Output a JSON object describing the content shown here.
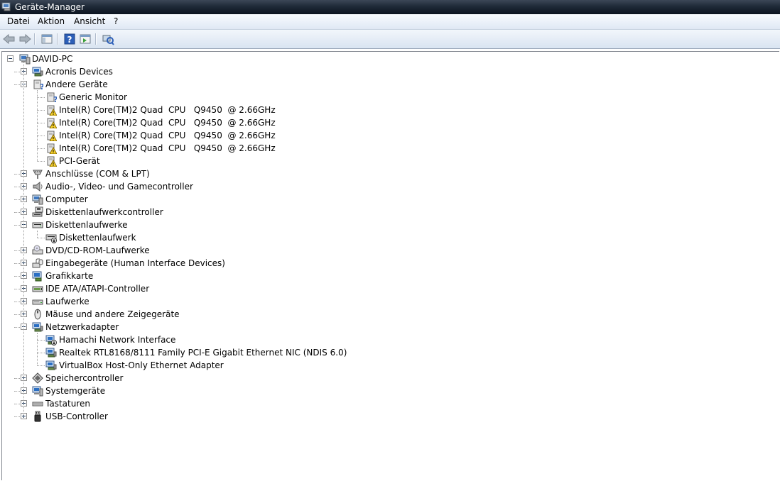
{
  "window": {
    "title": "Geräte-Manager"
  },
  "menu": {
    "items": [
      "Datei",
      "Aktion",
      "Ansicht",
      "?"
    ]
  },
  "tree": {
    "root": "DAVID-PC",
    "nodes": [
      {
        "label": "Acronis Devices",
        "level": 1,
        "state": "collapsed",
        "icon": "network-adapter-icon"
      },
      {
        "label": "Andere Geräte",
        "level": 1,
        "state": "expanded",
        "icon": "unknown-device-icon"
      },
      {
        "label": "Generic Monitor",
        "level": 2,
        "icon": "unknown-device-icon"
      },
      {
        "label": "Intel(R) Core(TM)2 Quad  CPU   Q9450  @ 2.66GHz",
        "level": 2,
        "icon": "warning-device-icon"
      },
      {
        "label": "Intel(R) Core(TM)2 Quad  CPU   Q9450  @ 2.66GHz",
        "level": 2,
        "icon": "warning-device-icon"
      },
      {
        "label": "Intel(R) Core(TM)2 Quad  CPU   Q9450  @ 2.66GHz",
        "level": 2,
        "icon": "warning-device-icon"
      },
      {
        "label": "Intel(R) Core(TM)2 Quad  CPU   Q9450  @ 2.66GHz",
        "level": 2,
        "icon": "warning-device-icon"
      },
      {
        "label": "PCI-Gerät",
        "level": 2,
        "icon": "warning-device-icon"
      },
      {
        "label": "Anschlüsse (COM & LPT)",
        "level": 1,
        "state": "collapsed",
        "icon": "port-icon"
      },
      {
        "label": "Audio-, Video- und Gamecontroller",
        "level": 1,
        "state": "collapsed",
        "icon": "speaker-icon"
      },
      {
        "label": "Computer",
        "level": 1,
        "state": "collapsed",
        "icon": "computer-icon"
      },
      {
        "label": "Diskettenlaufwerkcontroller",
        "level": 1,
        "state": "collapsed",
        "icon": "floppy-controller-icon"
      },
      {
        "label": "Diskettenlaufwerke",
        "level": 1,
        "state": "expanded",
        "icon": "floppy-drive-icon"
      },
      {
        "label": "Diskettenlaufwerk",
        "level": 2,
        "icon": "floppy-drive-disabled-icon"
      },
      {
        "label": "DVD/CD-ROM-Laufwerke",
        "level": 1,
        "state": "collapsed",
        "icon": "dvd-drive-icon"
      },
      {
        "label": "Eingabegeräte (Human Interface Devices)",
        "level": 1,
        "state": "collapsed",
        "icon": "hid-icon"
      },
      {
        "label": "Grafikkarte",
        "level": 1,
        "state": "collapsed",
        "icon": "display-adapter-icon"
      },
      {
        "label": "IDE ATA/ATAPI-Controller",
        "level": 1,
        "state": "collapsed",
        "icon": "ide-controller-icon"
      },
      {
        "label": "Laufwerke",
        "level": 1,
        "state": "collapsed",
        "icon": "disk-drive-icon"
      },
      {
        "label": "Mäuse und andere Zeigegeräte",
        "level": 1,
        "state": "collapsed",
        "icon": "mouse-icon"
      },
      {
        "label": "Netzwerkadapter",
        "level": 1,
        "state": "expanded",
        "icon": "network-adapter-icon"
      },
      {
        "label": "Hamachi Network Interface",
        "level": 2,
        "icon": "network-adapter-disabled-icon"
      },
      {
        "label": "Realtek RTL8168/8111 Family PCI-E Gigabit Ethernet NIC (NDIS 6.0)",
        "level": 2,
        "icon": "network-adapter-icon"
      },
      {
        "label": "VirtualBox Host-Only Ethernet Adapter",
        "level": 2,
        "icon": "network-adapter-icon"
      },
      {
        "label": "Speichercontroller",
        "level": 1,
        "state": "collapsed",
        "icon": "storage-controller-icon"
      },
      {
        "label": "Systemgeräte",
        "level": 1,
        "state": "collapsed",
        "icon": "system-device-icon"
      },
      {
        "label": "Tastaturen",
        "level": 1,
        "state": "collapsed",
        "icon": "keyboard-icon"
      },
      {
        "label": "USB-Controller",
        "level": 1,
        "state": "collapsed",
        "icon": "usb-icon"
      }
    ]
  }
}
